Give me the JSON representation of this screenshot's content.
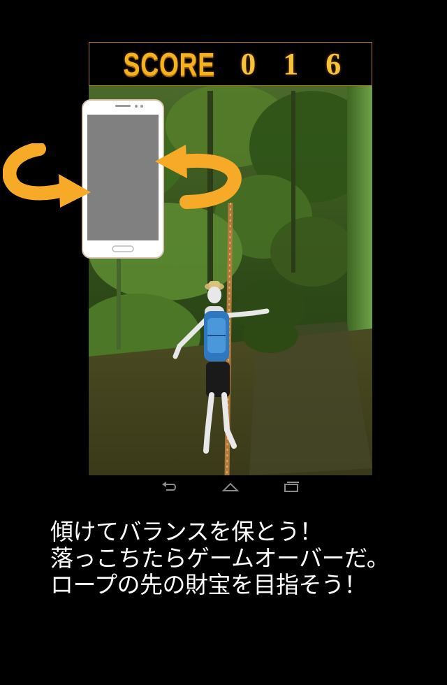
{
  "hud": {
    "score_label": "SCORE",
    "score_value": "0 1 6"
  },
  "controls": {
    "phone_icon": "smartphone-icon",
    "rotate_left_icon": "curved-arrow-left-icon",
    "rotate_right_icon": "curved-arrow-right-icon"
  },
  "navigation": {
    "back_icon": "back-icon",
    "home_icon": "home-icon",
    "recents_icon": "recents-icon"
  },
  "instructions": {
    "line1": "傾けてバランスを保とう！",
    "line2": "落っこちたらゲームオーバーだ。",
    "line3": "ロープの先の財宝を目指そう！"
  },
  "colors": {
    "score_gold": "#f3b21e",
    "arrow_orange": "#f7a928",
    "background": "#000000"
  }
}
